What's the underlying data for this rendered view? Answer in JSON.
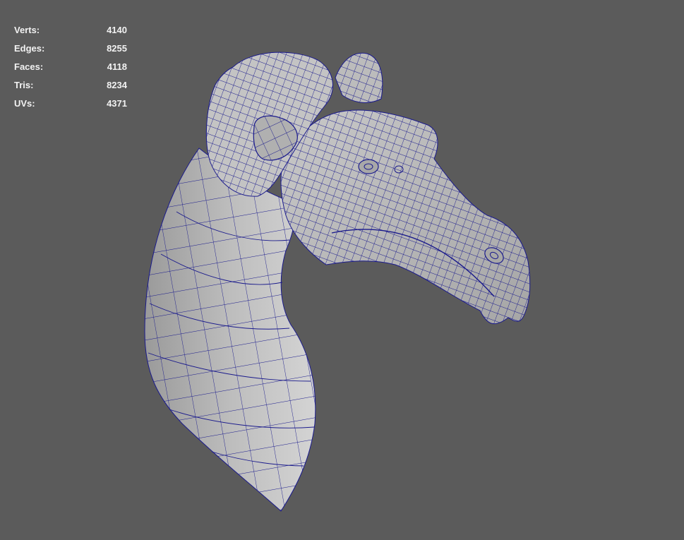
{
  "heads_up_display": {
    "poly_count": [
      {
        "label": "Verts:",
        "value": "4140"
      },
      {
        "label": "Edges:",
        "value": "8255"
      },
      {
        "label": "Faces:",
        "value": "4118"
      },
      {
        "label": "Tris:",
        "value": "8234"
      },
      {
        "label": "UVs:",
        "value": "4371"
      }
    ]
  },
  "viewport": {
    "background_color": "#5b5b5b",
    "mesh_shade_color": "#b4b4b4",
    "wireframe_color": "#1a1a8c",
    "subject": "creature-head-wireframe-model"
  }
}
